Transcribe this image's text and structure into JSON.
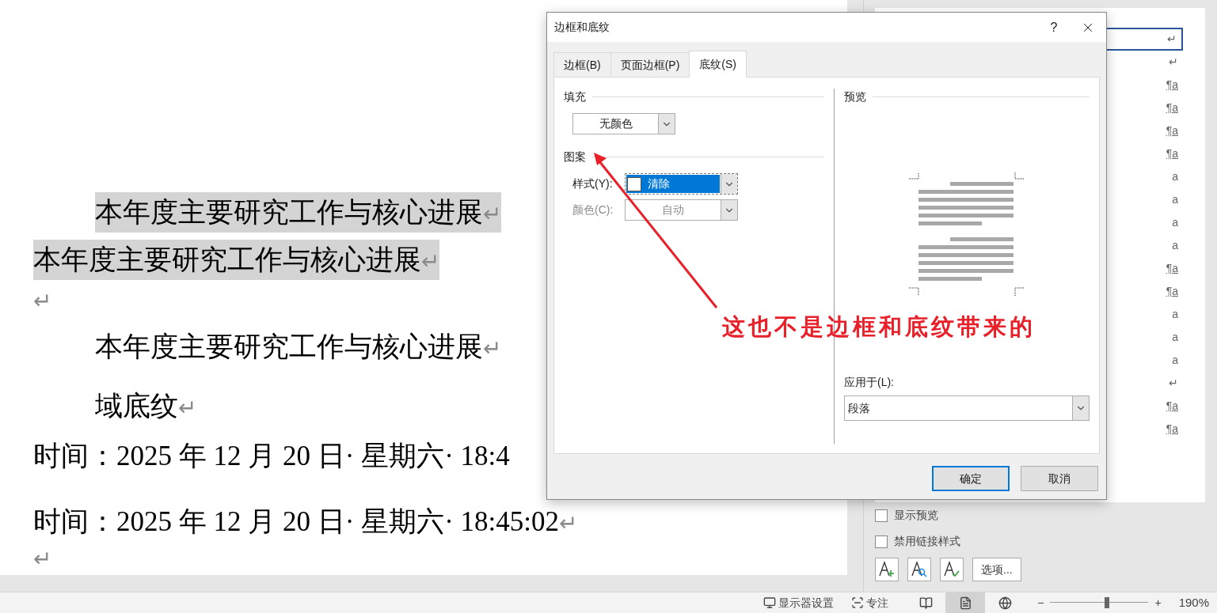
{
  "document": {
    "paragraphs": [
      {
        "kind": "body",
        "text": "本年度主要研究工作与核心进展",
        "indent": true,
        "shaded": true,
        "end_mark": "↵"
      },
      {
        "kind": "body",
        "text": "本年度主要研究工作与核心进展",
        "indent": false,
        "shaded": true,
        "end_mark": "↵"
      },
      {
        "kind": "empty",
        "indent": false,
        "shaded": false,
        "end_mark": "↵"
      },
      {
        "kind": "body",
        "text": "本年度主要研究工作与核心进展",
        "indent": true,
        "shaded": false,
        "end_mark": "↵"
      },
      {
        "kind": "body",
        "text": "域底纹",
        "indent": true,
        "shaded": false,
        "end_mark": "↵"
      },
      {
        "kind": "time",
        "text": "时间：2025 年 12 月 20 日· 星期六· 18:4",
        "indent": false,
        "shaded": false
      },
      {
        "kind": "time",
        "text": "时间：2025 年 12 月 20 日· 星期六· 18:45:02",
        "indent": false,
        "shaded": false,
        "end_mark": "↵"
      },
      {
        "kind": "empty",
        "indent": false,
        "shaded": false,
        "end_mark": "↵"
      }
    ]
  },
  "styles_pane": {
    "marks": [
      {
        "mark": "↵",
        "selected": true
      },
      {
        "mark": "↵",
        "selected": false
      },
      {
        "mark": "¶a",
        "selected": false
      },
      {
        "mark": "¶a",
        "selected": false
      },
      {
        "mark": "¶a",
        "selected": false
      },
      {
        "mark": "¶a",
        "selected": false
      },
      {
        "mark": "a",
        "selected": false
      },
      {
        "mark": "a",
        "selected": false
      },
      {
        "mark": "a",
        "selected": false
      },
      {
        "mark": "a",
        "selected": false
      },
      {
        "mark": "¶a",
        "selected": false
      },
      {
        "mark": "¶a",
        "selected": false
      },
      {
        "mark": "a",
        "selected": false
      },
      {
        "mark": "a",
        "selected": false
      },
      {
        "mark": "a",
        "selected": false
      },
      {
        "mark": "↵",
        "selected": false
      },
      {
        "mark": "¶a",
        "selected": false
      },
      {
        "mark": "¶a",
        "selected": false
      }
    ],
    "options": [
      {
        "label": "显示预览",
        "checked": false
      },
      {
        "label": "禁用链接样式",
        "checked": false
      }
    ],
    "options_button": "选项..."
  },
  "dialog": {
    "title": "边框和底纹",
    "help": "?",
    "tabs": [
      {
        "label": "边框(B)",
        "selected": false
      },
      {
        "label": "页面边框(P)",
        "selected": false
      },
      {
        "label": "底纹(S)",
        "selected": true
      }
    ],
    "fill": {
      "heading": "填充",
      "value": "无颜色"
    },
    "pattern": {
      "heading": "图案",
      "style_label": "样式(Y):",
      "style_value": "清除",
      "color_label": "颜色(C):",
      "color_value": "自动",
      "color_disabled": true
    },
    "preview": {
      "heading": "预览"
    },
    "apply_to": {
      "label": "应用于(L):",
      "value": "段落"
    },
    "buttons": [
      {
        "label": "确定",
        "focused": true
      },
      {
        "label": "取消",
        "focused": false
      }
    ]
  },
  "annotation": {
    "text": "这也不是边框和底纹带来的"
  },
  "status_bar": {
    "display_settings": "显示器设置",
    "focus": "专注",
    "views": [
      {
        "kind": "read",
        "selected": false
      },
      {
        "kind": "print",
        "selected": true
      },
      {
        "kind": "web",
        "selected": false
      }
    ],
    "zoom": {
      "minus": "−",
      "plus": "+",
      "level": 0.58,
      "reading": "190%"
    }
  }
}
